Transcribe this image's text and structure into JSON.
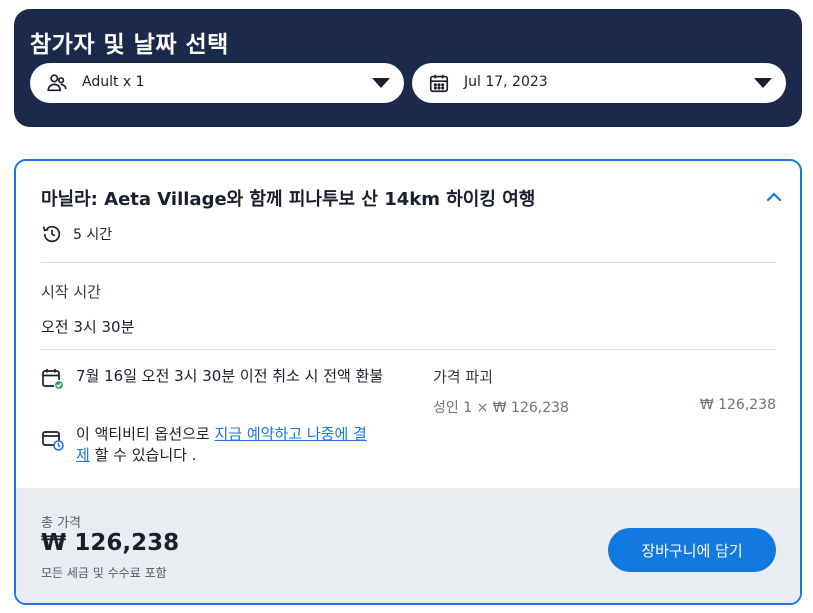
{
  "header": {
    "title": "참가자 및 날짜 선택",
    "participants": {
      "value": "Adult x 1",
      "icon": "participants-icon"
    },
    "date": {
      "value": "Jul 17, 2023",
      "icon": "calendar-icon"
    }
  },
  "tour": {
    "title": "마닐라: Aeta Village와 함께 피나투보 산 14km 하이킹 여행",
    "duration": "5 시간",
    "start_time_label": "시작 시간",
    "start_time_value": "오전 3시 30분",
    "cancellation": "7월 16일 오전 3시 30분 이전 취소 시 전액 환불",
    "reserve_prefix": "이 액티비티 옵션으로 ",
    "reserve_link": "지금 예약하고 나중에 결제",
    "reserve_suffix": " 할 수 있습니다 ."
  },
  "price": {
    "breakdown_title": "가격 파괴",
    "line_label": "성인 1 × ₩ 126,238",
    "line_amount": "₩ 126,238",
    "total_label": "총 가격",
    "total_value": "₩ 126,238",
    "total_note": "모든 세금 및 수수료 포함"
  },
  "actions": {
    "add_to_cart": "장바구니에 담기"
  },
  "colors": {
    "header_bg": "#1b2a4a",
    "accent": "#1a78e0",
    "footer_bg": "#e9ecf0"
  }
}
